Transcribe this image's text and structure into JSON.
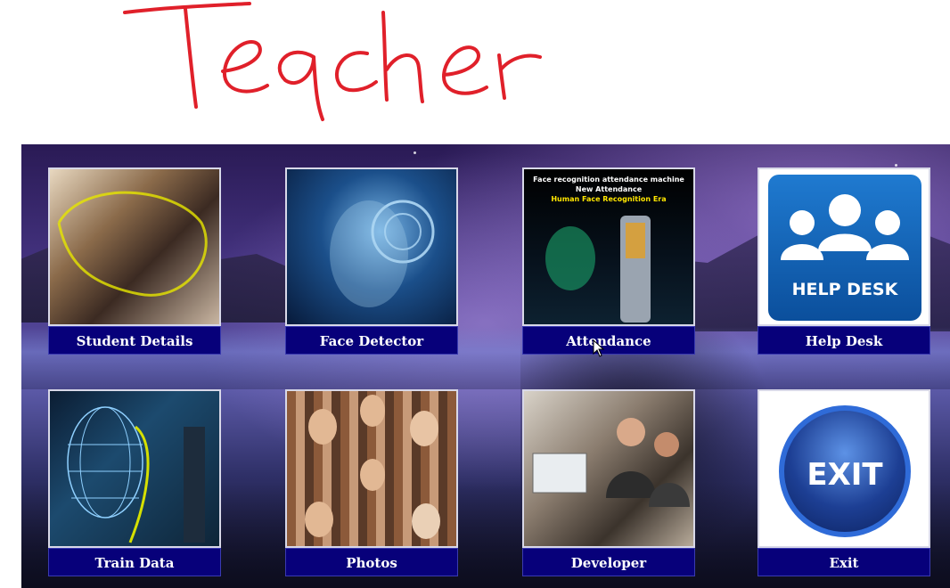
{
  "annotation": {
    "handwritten_text": "Teacher",
    "ink_color": "#e0202a"
  },
  "tiles": [
    {
      "label": "Student Details"
    },
    {
      "label": "Face Detector"
    },
    {
      "label": "Attendance"
    },
    {
      "label": "Help Desk"
    },
    {
      "label": "Train Data"
    },
    {
      "label": "Photos"
    },
    {
      "label": "Developer"
    },
    {
      "label": "Exit"
    }
  ],
  "attendance_image": {
    "line1": "Face recognition attendance machine",
    "line2": "New Attendance",
    "line3": "Human Face Recognition Era"
  },
  "helpdesk_image": {
    "text": "HELP DESK"
  },
  "exit_image": {
    "text": "EXIT"
  },
  "colors": {
    "caption_bg": "#07007a",
    "caption_text": "#ffffff",
    "attendance_line3": "#ffe600"
  }
}
